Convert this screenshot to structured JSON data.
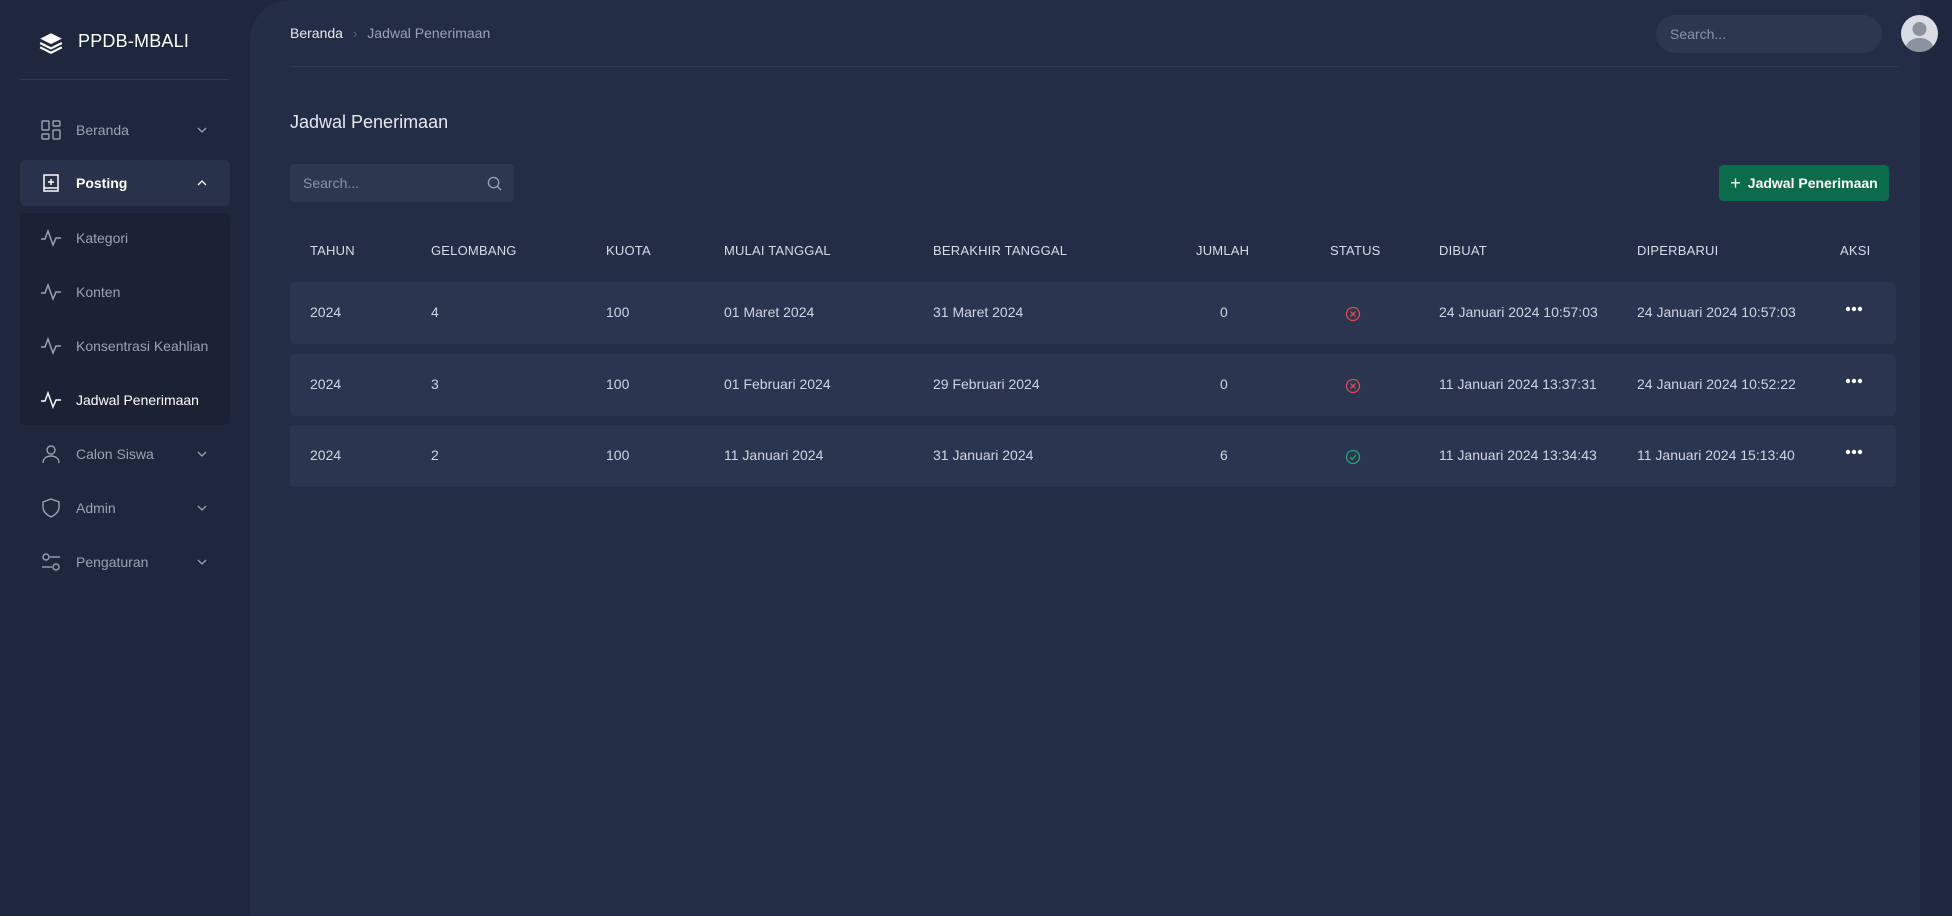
{
  "app": {
    "title": "PPDB-MBALI"
  },
  "sidebar": {
    "items": [
      {
        "label": "Beranda",
        "icon": "dashboard-icon"
      },
      {
        "label": "Posting",
        "icon": "add-document-icon"
      },
      {
        "label": "Calon Siswa",
        "icon": "user-icon"
      },
      {
        "label": "Admin",
        "icon": "shield-icon"
      },
      {
        "label": "Pengaturan",
        "icon": "settings-sliders-icon"
      }
    ],
    "submenu": [
      {
        "label": "Kategori",
        "icon": "activity-icon"
      },
      {
        "label": "Konten",
        "icon": "activity-icon"
      },
      {
        "label": "Konsentrasi Keahlian",
        "icon": "activity-icon"
      },
      {
        "label": "Jadwal Penerimaan",
        "icon": "activity-icon"
      }
    ]
  },
  "header": {
    "breadcrumb": [
      "Beranda",
      "Jadwal Penerimaan"
    ],
    "search_placeholder": "Search..."
  },
  "page": {
    "title": "Jadwal Penerimaan",
    "search_placeholder": "Search...",
    "add_button": "Jadwal Penerimaan"
  },
  "table": {
    "columns": [
      "TAHUN",
      "GELOMBANG",
      "KUOTA",
      "MULAI TANGGAL",
      "BERAKHIR TANGGAL",
      "JUMLAH",
      "STATUS",
      "DIBUAT",
      "DIPERBARUI",
      "AKSI"
    ],
    "rows": [
      {
        "tahun": "2024",
        "gelombang": "4",
        "kuota": "100",
        "mulai": "01 Maret 2024",
        "berakhir": "31 Maret 2024",
        "jumlah": "0",
        "status": "inactive",
        "dibuat": "24 Januari 2024 10:57:03",
        "diperbarui": "24 Januari 2024 10:57:03"
      },
      {
        "tahun": "2024",
        "gelombang": "3",
        "kuota": "100",
        "mulai": "01 Februari 2024",
        "berakhir": "29 Februari 2024",
        "jumlah": "0",
        "status": "inactive",
        "dibuat": "11 Januari 2024 13:37:31",
        "diperbarui": "24 Januari 2024 10:52:22"
      },
      {
        "tahun": "2024",
        "gelombang": "2",
        "kuota": "100",
        "mulai": "11 Januari 2024",
        "berakhir": "31 Januari 2024",
        "jumlah": "6",
        "status": "active",
        "dibuat": "11 Januari 2024 13:34:43",
        "diperbarui": "11 Januari 2024 15:13:40"
      }
    ]
  },
  "colors": {
    "accent_green": "#0c6b4a",
    "status_active": "#1ea672",
    "status_inactive": "#e5484d"
  }
}
